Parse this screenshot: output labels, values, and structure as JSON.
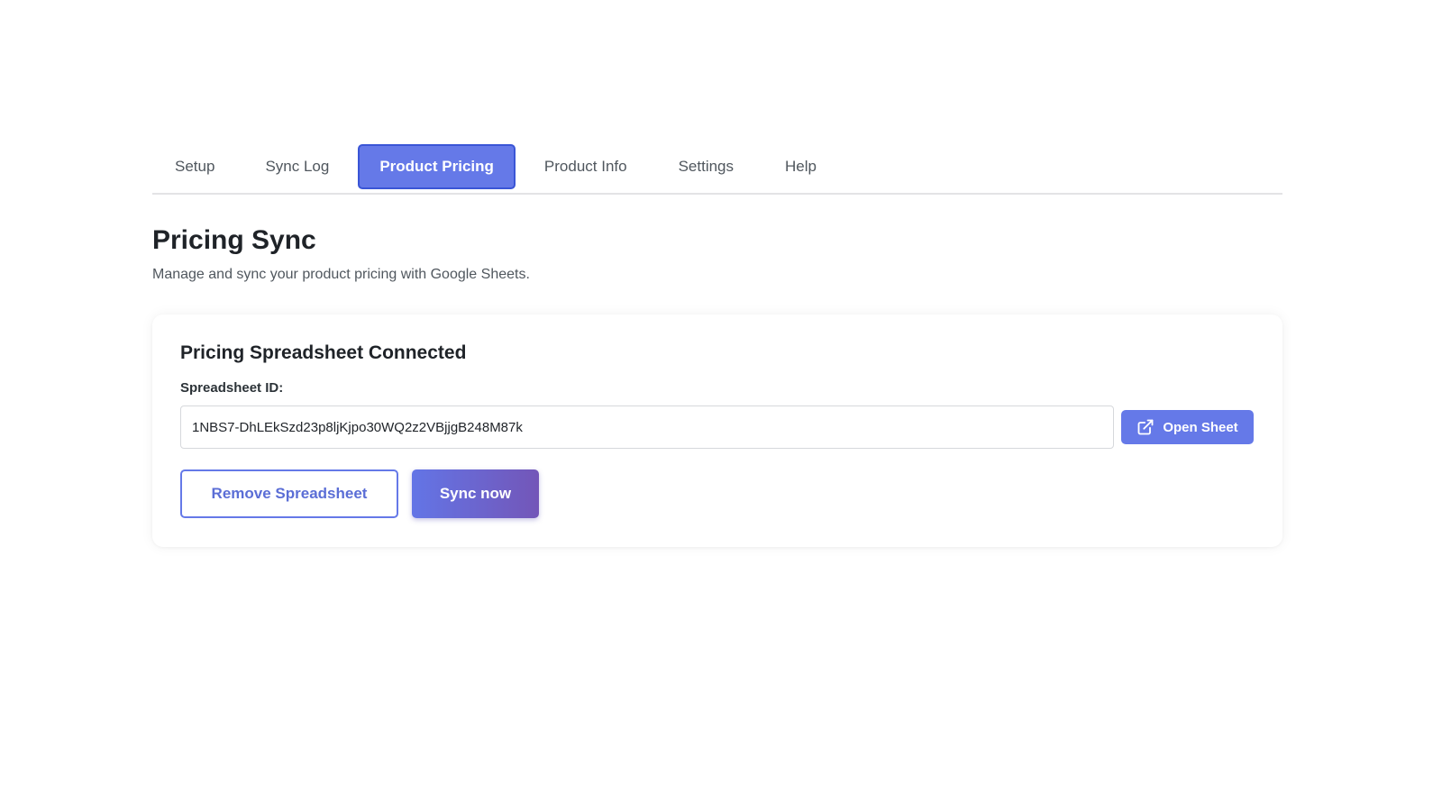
{
  "tabs": [
    {
      "label": "Setup"
    },
    {
      "label": "Sync Log"
    },
    {
      "label": "Product Pricing",
      "active": true
    },
    {
      "label": "Product Info"
    },
    {
      "label": "Settings"
    },
    {
      "label": "Help"
    }
  ],
  "page": {
    "title": "Pricing Sync",
    "subtitle": "Manage and sync your product pricing with Google Sheets."
  },
  "card": {
    "title": "Pricing Spreadsheet Connected",
    "field_label": "Spreadsheet ID:",
    "spreadsheet_id": "1NBS7-DhLEkSzd23p8ljKjpo30WQ2z2VBjjgB248M87k",
    "open_label": "Open Sheet",
    "open_icon": "external-link-icon",
    "remove_label": "Remove Spreadsheet",
    "sync_label": "Sync now"
  },
  "colors": {
    "accent": "#6579e8",
    "accent_border": "#3a55d6",
    "sync_gradient_start": "#6375e6",
    "sync_gradient_end": "#7356b8"
  }
}
